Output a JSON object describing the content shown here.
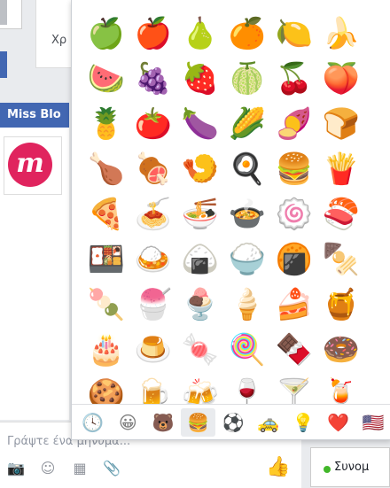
{
  "background": {
    "partial_text": "Χρ",
    "chat_title": "Miss Blo",
    "avatar_letter": "m",
    "compose_placeholder": "Γράψτε ένα μήνυμα...",
    "status_label": "Συνομ"
  },
  "compose_icons": [
    {
      "icon": "camera-icon",
      "glyph": "📷"
    },
    {
      "icon": "smiley-icon",
      "glyph": "☺"
    },
    {
      "icon": "sticker-icon",
      "glyph": "▦"
    },
    {
      "icon": "attachment-icon",
      "glyph": "📎"
    }
  ],
  "like_glyph": "👍",
  "emoji_rows": [
    [
      "🍏",
      "🍎",
      "🍐",
      "🍊",
      "🍋",
      "🍌"
    ],
    [
      "🍉",
      "🍇",
      "🍓",
      "🍈",
      "🍒",
      "🍑"
    ],
    [
      "🍍",
      "🍅",
      "🍆",
      "🌽",
      "🍠",
      "🍞"
    ],
    [
      "🍗",
      "🍖",
      "🍤",
      "🍳",
      "🍔",
      "🍟"
    ],
    [
      "🍕",
      "🍝",
      "🍜",
      "🍲",
      "🍥",
      "🍣"
    ],
    [
      "🍱",
      "🍛",
      "🍙",
      "🍚",
      "🍘",
      "🍢"
    ],
    [
      "🍡",
      "🍧",
      "🍨",
      "🍦",
      "🍰",
      "🍯"
    ],
    [
      "🎂",
      "🍮",
      "🍬",
      "🍭",
      "🍫",
      "🍩"
    ],
    [
      "🍪",
      "🍺",
      "🍻",
      "🍷",
      "🍸",
      "🍹"
    ]
  ],
  "tabs": [
    {
      "icon": "clock-icon",
      "glyph": "🕓"
    },
    {
      "icon": "smileys-tab-icon",
      "glyph": "😀"
    },
    {
      "icon": "animals-tab-icon",
      "glyph": "🐻"
    },
    {
      "icon": "food-tab-icon",
      "glyph": "🍔",
      "active": true
    },
    {
      "icon": "activity-tab-icon",
      "glyph": "⚽"
    },
    {
      "icon": "travel-tab-icon",
      "glyph": "🚕"
    },
    {
      "icon": "objects-tab-icon",
      "glyph": "💡"
    },
    {
      "icon": "symbols-tab-icon",
      "glyph": "❤️"
    },
    {
      "icon": "flags-tab-icon",
      "glyph": "🇺🇸"
    }
  ]
}
